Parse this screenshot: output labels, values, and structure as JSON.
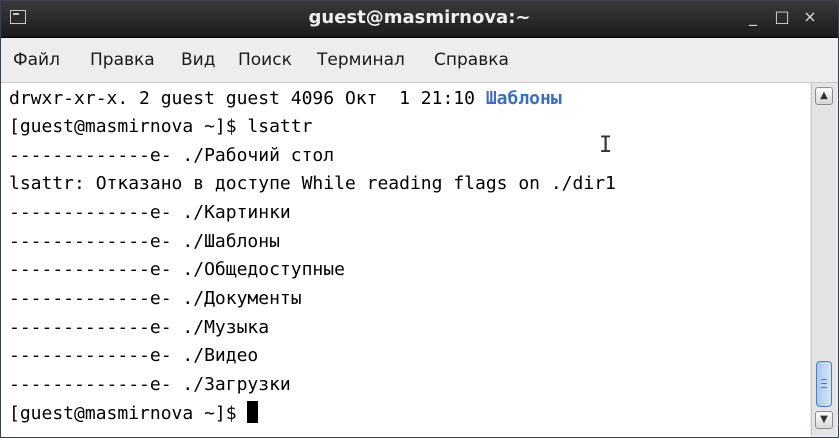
{
  "window": {
    "title": "guest@masmirnova:~",
    "controls": {
      "minimize": "_",
      "maximize": "□",
      "close": "×"
    }
  },
  "menu": {
    "items": [
      "Файл",
      "Правка",
      "Вид",
      "Поиск",
      "Терминал",
      "Справка"
    ]
  },
  "terminal": {
    "line0_prefix": "drwxr-xr-x. 2 guest guest 4096 Окт  1 21:10 ",
    "line0_dir": "Шаблоны",
    "lines": [
      "[guest@masmirnova ~]$ lsattr",
      "-------------e- ./Рабочий стол",
      "lsattr: Отказано в доступе While reading flags on ./dir1",
      "-------------e- ./Картинки",
      "-------------e- ./Шаблоны",
      "-------------e- ./Общедоступные",
      "-------------e- ./Документы",
      "-------------e- ./Музыка",
      "-------------e- ./Видео",
      "-------------e- ./Загрузки"
    ],
    "prompt": "[guest@masmirnova ~]$ ",
    "dir_color": "#3b6fc2"
  },
  "icons": {
    "window_icon": "terminal-icon",
    "mouse_cursor": "text-ibeam-icon",
    "ibeam_glyph": "I"
  }
}
